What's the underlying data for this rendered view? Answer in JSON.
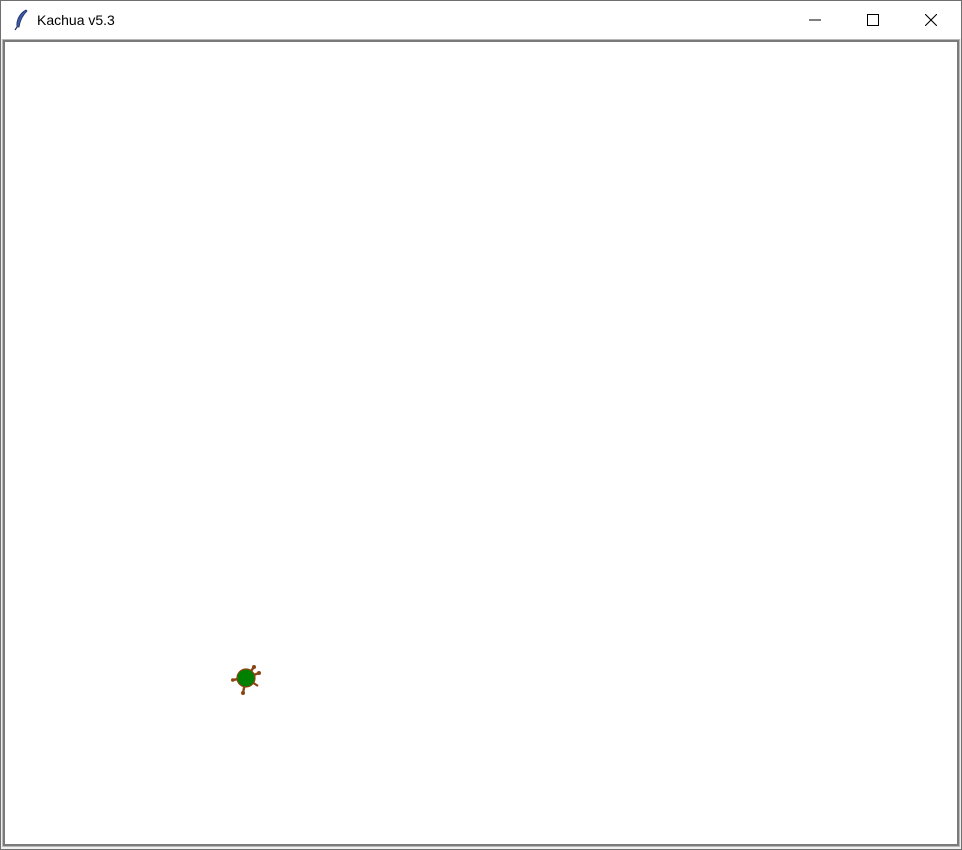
{
  "window": {
    "title": "Kachua v5.3",
    "app_icon": "feather-icon"
  },
  "titlebar_controls": {
    "minimize_icon": "minimize-icon",
    "maximize_icon": "maximize-icon",
    "close_icon": "close-icon"
  },
  "canvas": {
    "background": "#ffffff",
    "turtle": {
      "icon": "turtle-icon",
      "shell_color": "#008000",
      "limb_color": "#8b4513"
    }
  }
}
